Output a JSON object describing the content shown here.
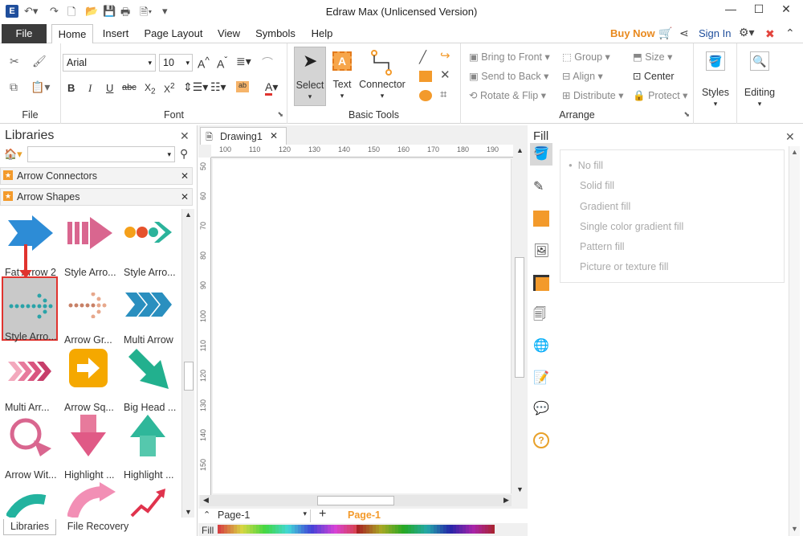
{
  "titlebar": {
    "title": "Edraw Max (Unlicensed Version)",
    "minimize": "—",
    "maximize": "☐",
    "close": "✕"
  },
  "menu": {
    "file": "File",
    "tabs": [
      "Home",
      "Insert",
      "Page Layout",
      "View",
      "Symbols",
      "Help"
    ],
    "buy_now": "Buy Now",
    "sign_in": "Sign In"
  },
  "ribbon": {
    "groups": {
      "file": "File",
      "font": "Font",
      "basic_tools": "Basic Tools",
      "arrange": "Arrange"
    },
    "font_name": "Arial",
    "font_size": "10",
    "basic_tools": {
      "select": "Select",
      "text": "Text",
      "connector": "Connector"
    },
    "arrange": {
      "bring_to_front": "Bring to Front",
      "send_to_back": "Send to Back",
      "rotate_flip": "Rotate & Flip",
      "group": "Group",
      "align": "Align",
      "distribute": "Distribute",
      "size": "Size",
      "center": "Center",
      "protect": "Protect"
    },
    "styles": "Styles",
    "editing": "Editing"
  },
  "libraries": {
    "title": "Libraries",
    "search_placeholder": "",
    "sections": [
      "Arrow Connectors",
      "Arrow Shapes"
    ],
    "shapes": [
      {
        "label": "Fat Arrow 2"
      },
      {
        "label": "Style Arro..."
      },
      {
        "label": "Style Arro..."
      },
      {
        "label": "Style Arro..."
      },
      {
        "label": "Arrow Gr..."
      },
      {
        "label": "Multi Arrow"
      },
      {
        "label": "Multi Arr..."
      },
      {
        "label": "Arrow Sq..."
      },
      {
        "label": "Big Head ..."
      },
      {
        "label": "Arrow Wit..."
      },
      {
        "label": "Highlight ..."
      },
      {
        "label": "Highlight ..."
      }
    ],
    "bottom_tabs": [
      "Libraries",
      "File Recovery"
    ]
  },
  "document": {
    "tab_title": "Drawing1",
    "ruler_h": [
      "100",
      "110",
      "120",
      "130",
      "140",
      "150",
      "160",
      "170",
      "180",
      "190"
    ],
    "ruler_v": [
      "50",
      "60",
      "70",
      "80",
      "90",
      "100",
      "110",
      "120",
      "130",
      "140",
      "150"
    ],
    "page_select": "Page-1",
    "page_tab": "Page-1",
    "fill_label": "Fill"
  },
  "fill_panel": {
    "title": "Fill",
    "options": [
      "No fill",
      "Solid fill",
      "Gradient fill",
      "Single color gradient fill",
      "Pattern fill",
      "Picture or texture fill"
    ],
    "selected": "No fill"
  },
  "colors": {
    "accent_orange": "#f39a2b",
    "highlight_red": "#e0332e",
    "selected_bg": "#c9c9c9",
    "file_tab_bg": "#3b3b3b"
  }
}
